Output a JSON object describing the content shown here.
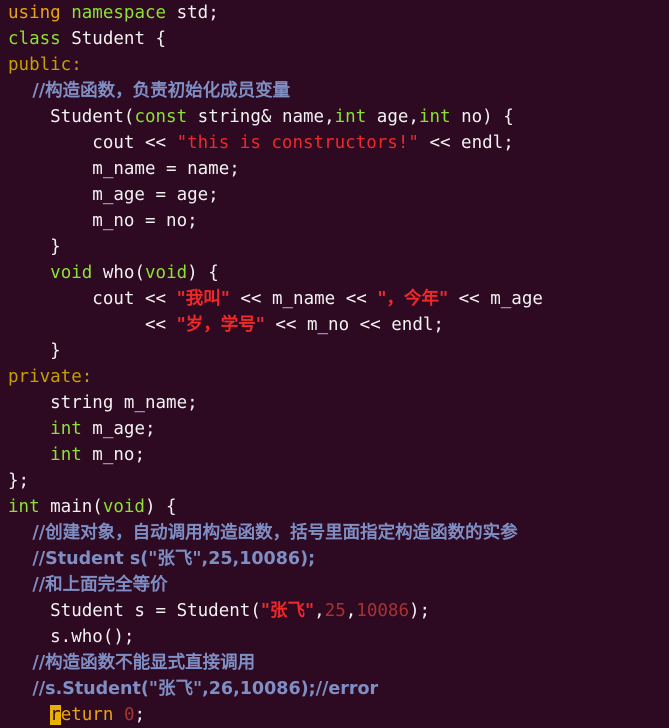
{
  "editor": {
    "background_color": "#2d0922",
    "colors": {
      "plain_text": "#f2f2f2",
      "keyword_green": "#8ae234",
      "keyword_orange": "#e8a317",
      "access_specifier_olive": "#c4a000",
      "string_red": "#ef2929",
      "number_dark_red": "#a63232",
      "comment_blue_gray": "#7f8fc4",
      "cursor_yellow": "#e9b000"
    },
    "language": "C++",
    "cursor": {
      "line_index": 24,
      "character": "r",
      "on_token": "return"
    },
    "lines": [
      {
        "index": 0,
        "tokens": [
          {
            "text": "using",
            "type": "keyword_orange"
          },
          {
            "text": " ",
            "type": "plain"
          },
          {
            "text": "namespace",
            "type": "keyword_green"
          },
          {
            "text": " std;",
            "type": "plain"
          }
        ]
      },
      {
        "index": 1,
        "tokens": [
          {
            "text": "class",
            "type": "keyword_green"
          },
          {
            "text": " Student {",
            "type": "plain"
          }
        ]
      },
      {
        "index": 2,
        "tokens": [
          {
            "text": "public:",
            "type": "access_specifier"
          }
        ]
      },
      {
        "index": 3,
        "tokens": [
          {
            "text": "    //构造函数，负责初始化成员变量",
            "type": "comment_cjk"
          }
        ]
      },
      {
        "index": 4,
        "tokens": [
          {
            "text": "    Student(",
            "type": "plain"
          },
          {
            "text": "const",
            "type": "keyword_green"
          },
          {
            "text": " string& name,",
            "type": "plain"
          },
          {
            "text": "int",
            "type": "keyword_green"
          },
          {
            "text": " age,",
            "type": "plain"
          },
          {
            "text": "int",
            "type": "keyword_green"
          },
          {
            "text": " no) {",
            "type": "plain"
          }
        ]
      },
      {
        "index": 5,
        "tokens": [
          {
            "text": "        cout << ",
            "type": "plain"
          },
          {
            "text": "\"this is constructors!\"",
            "type": "string"
          },
          {
            "text": " << endl;",
            "type": "plain"
          }
        ]
      },
      {
        "index": 6,
        "tokens": [
          {
            "text": "        m_name = name;",
            "type": "plain"
          }
        ]
      },
      {
        "index": 7,
        "tokens": [
          {
            "text": "        m_age = age;",
            "type": "plain"
          }
        ]
      },
      {
        "index": 8,
        "tokens": [
          {
            "text": "        m_no = no;",
            "type": "plain"
          }
        ]
      },
      {
        "index": 9,
        "tokens": [
          {
            "text": "    }",
            "type": "plain"
          }
        ]
      },
      {
        "index": 10,
        "tokens": [
          {
            "text": "    ",
            "type": "plain"
          },
          {
            "text": "void",
            "type": "keyword_green"
          },
          {
            "text": " who(",
            "type": "plain"
          },
          {
            "text": "void",
            "type": "keyword_green"
          },
          {
            "text": ") {",
            "type": "plain"
          }
        ]
      },
      {
        "index": 11,
        "tokens": [
          {
            "text": "        cout << ",
            "type": "plain"
          },
          {
            "text": "\"我叫\"",
            "type": "string_cjk"
          },
          {
            "text": " << m_name << ",
            "type": "plain"
          },
          {
            "text": "\"，今年\"",
            "type": "string_cjk"
          },
          {
            "text": " << m_age",
            "type": "plain"
          }
        ]
      },
      {
        "index": 12,
        "tokens": [
          {
            "text": "             << ",
            "type": "plain"
          },
          {
            "text": "\"岁，学号\"",
            "type": "string_cjk"
          },
          {
            "text": " << m_no << endl;",
            "type": "plain"
          }
        ]
      },
      {
        "index": 13,
        "tokens": [
          {
            "text": "    }",
            "type": "plain"
          }
        ]
      },
      {
        "index": 14,
        "tokens": [
          {
            "text": "private:",
            "type": "access_specifier"
          }
        ]
      },
      {
        "index": 15,
        "tokens": [
          {
            "text": "    string m_name;",
            "type": "plain"
          }
        ]
      },
      {
        "index": 16,
        "tokens": [
          {
            "text": "    ",
            "type": "plain"
          },
          {
            "text": "int",
            "type": "keyword_green"
          },
          {
            "text": " m_age;",
            "type": "plain"
          }
        ]
      },
      {
        "index": 17,
        "tokens": [
          {
            "text": "    ",
            "type": "plain"
          },
          {
            "text": "int",
            "type": "keyword_green"
          },
          {
            "text": " m_no;",
            "type": "plain"
          }
        ]
      },
      {
        "index": 18,
        "tokens": [
          {
            "text": "};",
            "type": "plain"
          }
        ]
      },
      {
        "index": 19,
        "tokens": [
          {
            "text": "int",
            "type": "keyword_green"
          },
          {
            "text": " main(",
            "type": "plain"
          },
          {
            "text": "void",
            "type": "keyword_green"
          },
          {
            "text": ") {",
            "type": "plain"
          }
        ]
      },
      {
        "index": 20,
        "tokens": [
          {
            "text": "    //创建对象，自动调用构造函数，括号里面指定构造函数的实参",
            "type": "comment_cjk"
          }
        ]
      },
      {
        "index": 21,
        "tokens": [
          {
            "text": "    //Student s(\"张飞\",25,10086);",
            "type": "comment_cjk"
          }
        ]
      },
      {
        "index": 22,
        "tokens": [
          {
            "text": "    //和上面完全等价",
            "type": "comment_cjk"
          }
        ]
      },
      {
        "index": 23,
        "tokens": [
          {
            "text": "    Student s = Student(",
            "type": "plain"
          },
          {
            "text": "\"张飞\"",
            "type": "string_cjk"
          },
          {
            "text": ",",
            "type": "plain"
          },
          {
            "text": "25",
            "type": "number"
          },
          {
            "text": ",",
            "type": "plain"
          },
          {
            "text": "10086",
            "type": "number"
          },
          {
            "text": ");",
            "type": "plain"
          }
        ]
      },
      {
        "index": 24,
        "tokens": [
          {
            "text": "    s.who();",
            "type": "plain"
          }
        ]
      },
      {
        "index": 25,
        "tokens": [
          {
            "text": "    //构造函数不能显式直接调用",
            "type": "comment_cjk"
          }
        ]
      },
      {
        "index": 26,
        "tokens": [
          {
            "text": "    //s.Student(\"张飞\",26,10086);//error",
            "type": "comment_cjk"
          }
        ]
      },
      {
        "index": 27,
        "tokens": [
          {
            "text": "    ",
            "type": "plain"
          },
          {
            "text": "r",
            "type": "cursor"
          },
          {
            "text": "eturn",
            "type": "keyword_orange"
          },
          {
            "text": " ",
            "type": "plain"
          },
          {
            "text": "0",
            "type": "number"
          },
          {
            "text": ";",
            "type": "plain"
          }
        ]
      }
    ]
  }
}
